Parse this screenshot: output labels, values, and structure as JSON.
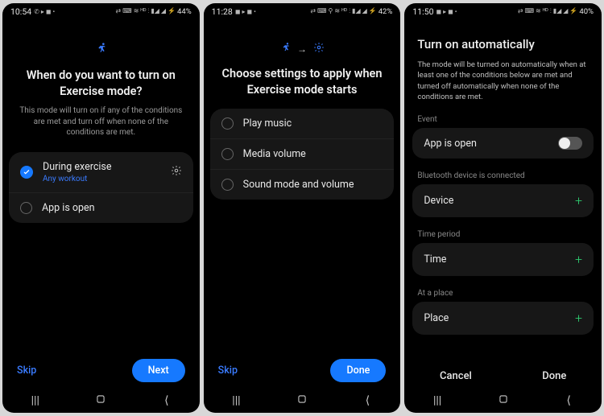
{
  "screen1": {
    "status": {
      "time": "10:54",
      "icons": "✆ ▷ ◼ •",
      "right": "⌐ ⌨ ⚡ ⋮ ◦ 📶 📶 ⚡ 44%",
      "battery": "44%"
    },
    "heading": "When do you want to turn on Exercise mode?",
    "subtext": "This mode will turn on if any of the conditions are met and turn off when none of the conditions are met.",
    "items": [
      {
        "title": "During exercise",
        "sub": "Any workout",
        "checked": true,
        "gear": true
      },
      {
        "title": "App is open",
        "checked": false
      }
    ],
    "skip": "Skip",
    "next": "Next"
  },
  "screen2": {
    "status": {
      "time": "11:28",
      "icons": "◼ ▷ ◼ •",
      "right": "⌐ ⌨ ⚡ 📍 ⋮ 📶 📶 ⚡ 42%",
      "battery": "42%"
    },
    "heading": "Choose settings to apply when Exercise mode starts",
    "items": [
      {
        "title": "Play music"
      },
      {
        "title": "Media volume"
      },
      {
        "title": "Sound mode and volume"
      }
    ],
    "skip": "Skip",
    "done": "Done"
  },
  "screen3": {
    "status": {
      "time": "11:50",
      "icons": "◼ ▷ ◼ •",
      "right": "⌐ ⌨ ⚡ ⋮ 📶 📶 ⚡ 40%",
      "battery": "40%"
    },
    "title": "Turn on automatically",
    "desc": "The mode will be turned on automatically when at least one of the conditions below are met and turned off automatically when none of the conditions are met.",
    "sections": [
      {
        "label": "Event",
        "item": "App is open",
        "control": "toggle"
      },
      {
        "label": "Bluetooth device is connected",
        "item": "Device",
        "control": "plus"
      },
      {
        "label": "Time period",
        "item": "Time",
        "control": "plus"
      },
      {
        "label": "At a place",
        "item": "Place",
        "control": "plus"
      }
    ],
    "cancel": "Cancel",
    "done": "Done"
  },
  "nav": {
    "recent": "|||",
    "home": "◯",
    "back": "⟨"
  }
}
